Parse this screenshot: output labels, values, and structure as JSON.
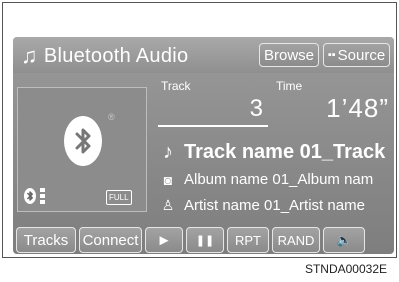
{
  "header": {
    "title": "Bluetooth Audio",
    "title_icon": "music-note-icon",
    "browse_label": "Browse",
    "source_label": "Source"
  },
  "player": {
    "track_label": "Track",
    "track_number": "3",
    "time_label": "Time",
    "time_value": "1’48”",
    "track_name": "Track name 01_Track",
    "album_name": "Album name 01_Album nam",
    "artist_name": "Artist name 01_Artist name"
  },
  "status": {
    "battery_label": "FULL",
    "device_icon": "bluetooth-icon"
  },
  "controls": {
    "tracks_label": "Tracks",
    "connect_label": "Connect",
    "play_symbol": "►",
    "pause_symbol": "❚❚",
    "rpt_label": "RPT",
    "rand_label": "RAND",
    "volume_symbol": "🔈"
  },
  "footer": {
    "code": "STNDA00032E"
  },
  "colors": {
    "screen_bg": "#8a8a8a",
    "text": "#ffffff"
  }
}
